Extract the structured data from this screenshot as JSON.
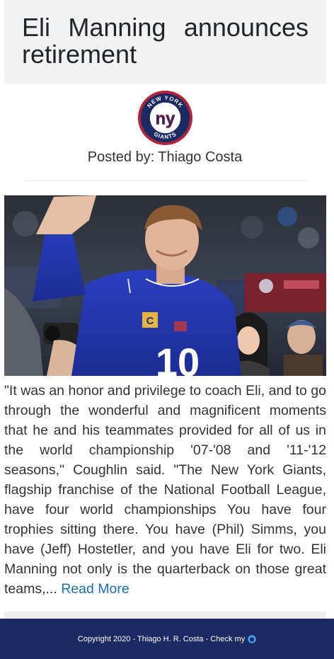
{
  "article": {
    "title": "Eli Manning announces retirement",
    "posted_by_label": "Posted by:",
    "author": "Thiago Costa",
    "team_logo": {
      "icon": "giants-logo-icon",
      "ring_top_text": "NEW YORK",
      "ring_bottom_text": "GIANTS",
      "monogram": "ny",
      "colors": {
        "navy": "#1b2a62",
        "red": "#b1243a",
        "white": "#ffffff"
      }
    },
    "hero_image": {
      "icon": "player-photo",
      "jersey_number": "10"
    },
    "body": "\"It was an honor and privilege to coach Eli, and to go through the wonderful and magnificent moments that he and his teammates provided for all of us in the world championship '07-'08 and '11-'12 seasons,\" Coughlin said. \"The New York Giants, flagship franchise of the National Football League, have four world championships You have four trophies sitting there. You have (Phil) Simms, you have (Jeff) Hostetler, and you have Eli for two. Eli Manning not only is the quarterback on those great teams,...",
    "read_more": "Read More"
  },
  "footer": {
    "text": "Copyright 2020 - Thiago H. R. Costa - Check my",
    "icon": "github-icon",
    "background": "#1b2a62"
  },
  "colors": {
    "link": "#1a6fb5",
    "title_bg": "#f2f2f2"
  }
}
